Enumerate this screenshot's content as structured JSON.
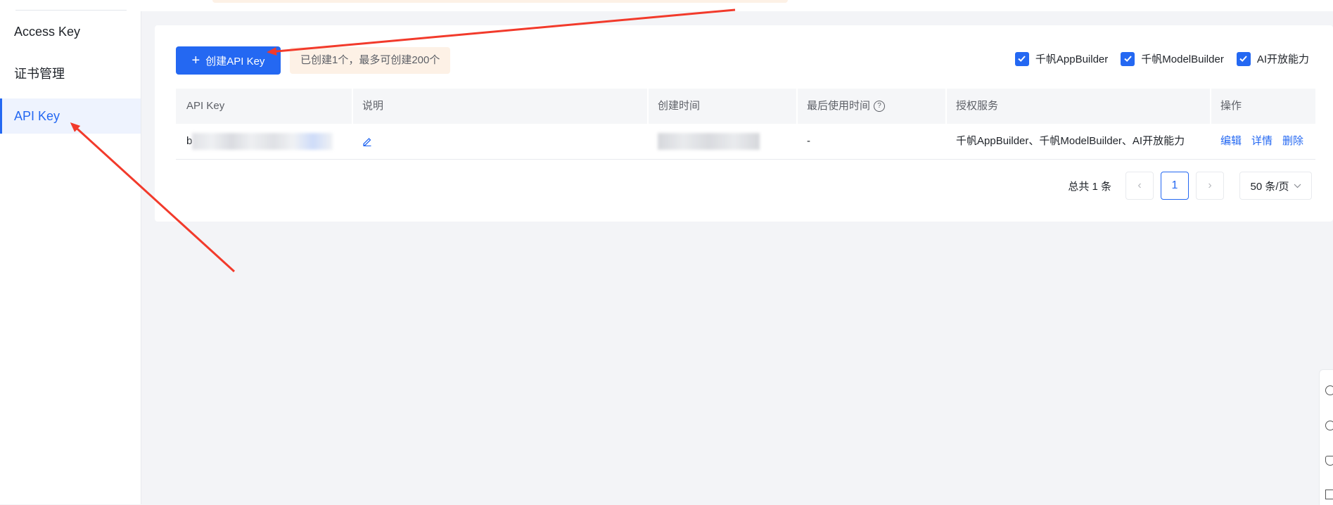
{
  "sidebar": {
    "items": [
      {
        "label": "Access Key",
        "active": false
      },
      {
        "label": "证书管理",
        "active": false
      },
      {
        "label": "API Key",
        "active": true
      }
    ]
  },
  "toolbar": {
    "create_label": "创建API Key",
    "create_icon": "plus-icon",
    "quota_tip": "已创建1个，最多可创建200个",
    "filters": [
      {
        "label": "千帆AppBuilder",
        "checked": true
      },
      {
        "label": "千帆ModelBuilder",
        "checked": true
      },
      {
        "label": "AI开放能力",
        "checked": true
      }
    ]
  },
  "table": {
    "columns": [
      "API Key",
      "说明",
      "创建时间",
      "最后使用时间",
      "授权服务",
      "操作"
    ],
    "rows": [
      {
        "api_key": "b",
        "description": "",
        "created_at": "",
        "last_used": "-",
        "services": "千帆AppBuilder、千帆ModelBuilder、AI开放能力",
        "actions": {
          "edit": "编辑",
          "detail": "详情",
          "delete": "删除"
        }
      }
    ]
  },
  "pagination": {
    "total": "总共 1 条",
    "current_page": "1",
    "page_size": "50 条/页"
  },
  "colors": {
    "accent": "#2468f2",
    "annotation": "#f23a2b",
    "tip_background": "#fdf1e6"
  }
}
